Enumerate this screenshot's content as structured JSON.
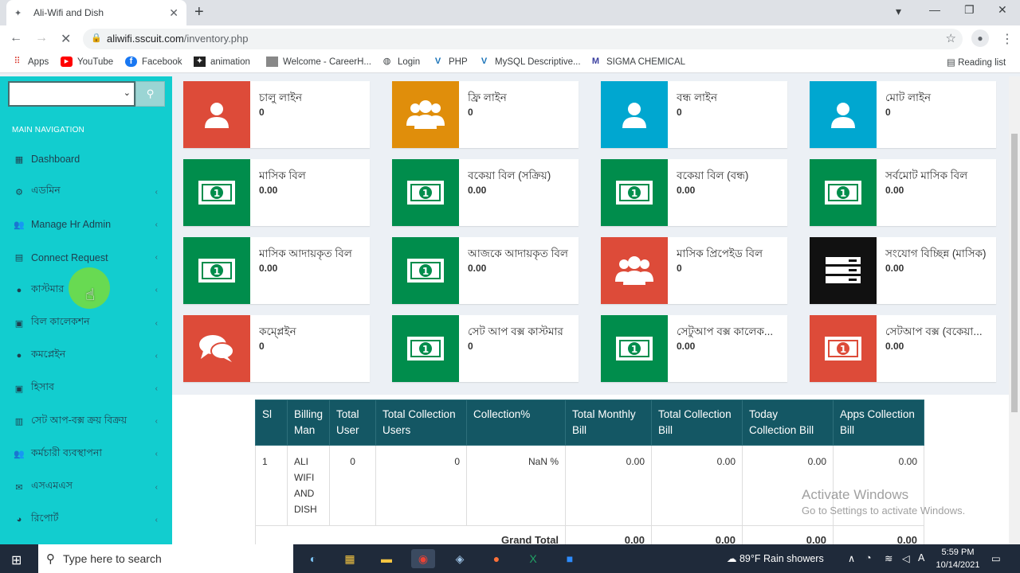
{
  "browser": {
    "tab_title": "Ali-Wifi and Dish",
    "tab_close": "✕",
    "new_tab": "+",
    "url_host": "aliwifi.sscuit.com",
    "url_path": "/inventory.php",
    "bookmarks": [
      {
        "label": "Apps",
        "icon": "apps-grid-icon"
      },
      {
        "label": "YouTube",
        "icon": "youtube-icon"
      },
      {
        "label": "Facebook",
        "icon": "facebook-icon"
      },
      {
        "label": "animation",
        "icon": "animation-icon"
      },
      {
        "label": "Welcome - CareerH...",
        "icon": "page-icon"
      },
      {
        "label": "Login",
        "icon": "globe-icon"
      },
      {
        "label": "PHP",
        "icon": "v-icon"
      },
      {
        "label": "MySQL Descriptive...",
        "icon": "v-icon"
      },
      {
        "label": "SIGMA CHEMICAL",
        "icon": "m-icon"
      }
    ],
    "reading_list": "Reading list"
  },
  "sidebar": {
    "nav_header": "MAIN NAVIGATION",
    "items": [
      {
        "label": "Dashboard",
        "icon": "dashboard-grid-icon",
        "arrow": ""
      },
      {
        "label": "এডমিন",
        "icon": "cogs-icon",
        "arrow": "‹"
      },
      {
        "label": "Manage Hr Admin",
        "icon": "users-icon",
        "arrow": "‹"
      },
      {
        "label": "Connect Request",
        "icon": "list-icon",
        "arrow": "‹"
      },
      {
        "label": "কাস্টমার",
        "icon": "user-icon",
        "arrow": "‹"
      },
      {
        "label": "বিল কালেকশন",
        "icon": "money-icon",
        "arrow": "‹"
      },
      {
        "label": "কমপ্লেইন",
        "icon": "comments-icon",
        "arrow": "‹"
      },
      {
        "label": "হিসাব",
        "icon": "money-icon",
        "arrow": "‹"
      },
      {
        "label": "সেট আপ-বক্স ক্রয় বিক্রয়",
        "icon": "basket-icon",
        "arrow": "‹"
      },
      {
        "label": "কর্মচারী ব্যবস্থাপনা",
        "icon": "users-icon",
        "arrow": "‹"
      },
      {
        "label": "এসএমএস",
        "icon": "envelope-icon",
        "arrow": "‹"
      },
      {
        "label": "রিপোর্ট",
        "icon": "pie-chart-icon",
        "arrow": "‹"
      }
    ]
  },
  "cards": [
    {
      "label": "চালু লাইন",
      "value": "0",
      "color": "#dd4b39",
      "icon": "user-icon"
    },
    {
      "label": "ফ্রি লাইন",
      "value": "0",
      "color": "#e08e0b",
      "icon": "users-icon"
    },
    {
      "label": "বন্ধ লাইন",
      "value": "0",
      "color": "#00a7d0",
      "icon": "user-icon"
    },
    {
      "label": "মোট লাইন",
      "value": "0",
      "color": "#00a7d0",
      "icon": "user-icon"
    },
    {
      "label": "মাসিক বিল",
      "value": "0.00",
      "color": "#008d4c",
      "icon": "money-icon"
    },
    {
      "label": "বকেয়া বিল (সক্রিয়)",
      "value": "0.00",
      "color": "#008d4c",
      "icon": "money-icon"
    },
    {
      "label": "বকেয়া বিল (বন্ধ)",
      "value": "0.00",
      "color": "#008d4c",
      "icon": "money-icon"
    },
    {
      "label": "সর্বমোট মাসিক বিল",
      "value": "0.00",
      "color": "#008d4c",
      "icon": "money-icon"
    },
    {
      "label": "মাসিক আদায়কৃত বিল",
      "value": "0.00",
      "color": "#008d4c",
      "icon": "money-icon"
    },
    {
      "label": "আজকে আদায়কৃত বিল",
      "value": "0.00",
      "color": "#008d4c",
      "icon": "money-icon"
    },
    {
      "label": "মাসিক প্রিপেইড বিল",
      "value": "0",
      "color": "#dd4b39",
      "icon": "users-icon"
    },
    {
      "label": "সংযোগ বিচ্ছিন্ন (মাসিক)",
      "value": "0.00",
      "color": "#111111",
      "icon": "server-icon"
    },
    {
      "label": "কম্প্লেইন",
      "value": "0",
      "color": "#dd4b39",
      "icon": "comments-icon"
    },
    {
      "label": "সেট আপ বক্স কাস্টমার",
      "value": "0",
      "color": "#008d4c",
      "icon": "money-icon"
    },
    {
      "label": "সেটুআপ বক্স কালেক...",
      "value": "0.00",
      "color": "#008d4c",
      "icon": "money-icon"
    },
    {
      "label": "সেটআপ বক্স (বকেয়া...",
      "value": "0.00",
      "color": "#dd4b39",
      "icon": "money-icon"
    }
  ],
  "table": {
    "headers": [
      "Sl",
      "Billing Man",
      "Total User",
      "Total Collection Users",
      "Collection%",
      "Total Monthly Bill",
      "Total Collection Bill",
      "Today Collection Bill",
      "Apps Collection Bill"
    ],
    "rows": [
      [
        "1",
        "ALI WIFI AND DISH",
        "0",
        "0",
        "NaN %",
        "0.00",
        "0.00",
        "0.00",
        "0.00"
      ]
    ],
    "grand_total_label": "Grand Total",
    "grand_total": [
      "0.00",
      "0.00",
      "0.00",
      "0.00"
    ]
  },
  "watermark": {
    "line1": "Activate Windows",
    "line2": "Go to Settings to activate Windows."
  },
  "taskbar": {
    "search_placeholder": "Type here to search",
    "weather": "89°F  Rain showers",
    "time": "5:59 PM",
    "date": "10/14/2021"
  }
}
